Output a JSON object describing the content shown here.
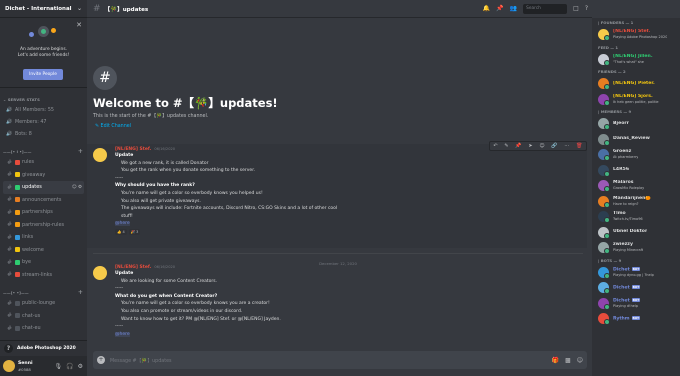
{
  "server": {
    "name": "Dichet - International"
  },
  "invite": {
    "line1": "An adventure begins.",
    "line2": "Let's add some friends!",
    "button": "Invite People"
  },
  "categories": {
    "stats": "SERVER STATS",
    "info": "——[• i •]——",
    "chat": "——[• •]——"
  },
  "stats": [
    {
      "label": "All Members: 55"
    },
    {
      "label": "Members: 47"
    },
    {
      "label": "Bots: 8"
    }
  ],
  "channels_info": [
    {
      "name": "rules",
      "emoji": "#e74c3c",
      "active": false
    },
    {
      "name": "giveaway",
      "emoji": "#f1c40f",
      "active": false
    },
    {
      "name": "updates",
      "emoji": "#2ecc71",
      "active": true
    },
    {
      "name": "announcements",
      "emoji": "#e67e22",
      "active": false
    },
    {
      "name": "partnerships",
      "emoji": "#f39c12",
      "active": false
    },
    {
      "name": "partnership-rules",
      "emoji": "#f39c12",
      "active": false
    },
    {
      "name": "links",
      "emoji": "#3498db",
      "active": false
    },
    {
      "name": "welcome",
      "emoji": "#f1c40f",
      "active": false
    },
    {
      "name": "bye",
      "emoji": "#2ecc71",
      "active": false
    },
    {
      "name": "stream-links",
      "emoji": "#e74c3c",
      "active": false
    }
  ],
  "channels_chat": [
    {
      "name": "public-lounge"
    },
    {
      "name": "chat-us"
    },
    {
      "name": "chat-eu"
    }
  ],
  "now_playing": "Adobe Photoshop 2020",
  "user": {
    "name": "Senni",
    "tag": "#0588"
  },
  "header": {
    "channel": "【🎋】updates",
    "search_placeholder": "Search"
  },
  "welcome": {
    "title": "Welcome to #【🎋】updates!",
    "subtitle": "This is the start of the #【🎋】updates channel.",
    "edit": "✎ Edit Channel"
  },
  "messages": [
    {
      "author": "[NL/ENG] Stef.",
      "time": "06/16/2020",
      "lines": [
        {
          "text": "Update",
          "style": "bold"
        },
        {
          "text": "We got a new rank, it is called Donator",
          "style": ""
        },
        {
          "text": "You get the rank when you donate something to the server.",
          "style": ""
        },
        {
          "text": "-----",
          "style": ""
        },
        {
          "text": "Why should you have the rank?",
          "style": "bold"
        },
        {
          "text": "You're name will get a color so everbody knows you helped us!",
          "style": ""
        },
        {
          "text": "You also will get private giveaways.",
          "style": ""
        },
        {
          "text": "The giveaways will include: Fortnite accounts, Discord Nitro, CS:GO Skins and a lot of other cool",
          "style": ""
        },
        {
          "text": "stuff!",
          "style": ""
        },
        {
          "text": "@here",
          "style": "mention"
        }
      ],
      "reactions": [
        "👍 4",
        "🎉 3"
      ]
    },
    {
      "author": "[NL/ENG] Stef.",
      "time": "06/16/2020",
      "lines": [
        {
          "text": "Update",
          "style": "bold"
        },
        {
          "text": "We are looking for some Content Creators.",
          "style": ""
        },
        {
          "text": "-----",
          "style": ""
        },
        {
          "text": "What do you get when Content Creator?",
          "style": "bold"
        },
        {
          "text": "You're name will get a color so everbody knows you are a creator!",
          "style": ""
        },
        {
          "text": "You also can promote or stream/videos in our discord.",
          "style": ""
        },
        {
          "text": "Want to know how to get it? PM @[NL/ENG] Stef. or @[NL/ENG] Jayden.",
          "style": ""
        },
        {
          "text": "-----",
          "style": ""
        },
        {
          "text": "@here",
          "style": "mention"
        }
      ],
      "reactions": []
    }
  ],
  "date_separator": "December 12, 2020",
  "composer": {
    "placeholder": "Message #【🎋】updates"
  },
  "member_groups": [
    {
      "title": "| FOUNDERS — 1",
      "members": [
        {
          "name": "[NL/ENG] Stef.",
          "status": "Playing Adobe Photoshop 2020",
          "color": "#e74c3c",
          "avatar": "#f6ca4a"
        }
      ]
    },
    {
      "title": "FEED — 1",
      "members": [
        {
          "name": "[NL/ENG] Jillen.",
          "status": "\"That's what\" she",
          "color": "#2ecc71",
          "avatar": "#c9cdd6"
        }
      ]
    },
    {
      "title": "FRIENDS — 2",
      "members": [
        {
          "name": "[NL/ENG] Pieter.",
          "status": "",
          "color": "#f1c40f",
          "avatar": "#e67e22"
        },
        {
          "name": "[NL/ENG] Sjors.",
          "status": "Ik heb geen politie, politie",
          "color": "#f1c40f",
          "avatar": "#8e44ad"
        }
      ]
    },
    {
      "title": "| MEMBERS — 9",
      "members": [
        {
          "name": "Bjeorr",
          "status": "",
          "color": "#dcddde",
          "avatar": "#95a5a6"
        },
        {
          "name": "Danas_Review",
          "status": "",
          "color": "#dcddde",
          "avatar": "#7f8c8d"
        },
        {
          "name": "Groenz",
          "status": "At pharmberry",
          "color": "#dcddde",
          "avatar": "#4a6fa5"
        },
        {
          "name": "L4R56",
          "status": "",
          "color": "#dcddde",
          "avatar": "#34495e"
        },
        {
          "name": "Malaros",
          "status": "GrowMix Roleplay",
          "color": "#dcddde",
          "avatar": "#9b59b6"
        },
        {
          "name": "Mandarijnen🍊",
          "status": "Have to reign?",
          "color": "#dcddde",
          "avatar": "#e67e22"
        },
        {
          "name": "Tlmo",
          "status": "Twitch.tv/Timo96",
          "color": "#dcddde",
          "avatar": "#2c3e50"
        },
        {
          "name": "Ubnel Doktor",
          "status": "",
          "color": "#dcddde",
          "avatar": "#bdc3c7"
        },
        {
          "name": "zwiezzy",
          "status": "Playing Minecraft",
          "color": "#dcddde",
          "avatar": "#95a5a6"
        }
      ]
    },
    {
      "title": "| BOTS — 9",
      "members": [
        {
          "name": "Dichet",
          "status": "Playing dyno.gg | ?help",
          "color": "#7289da",
          "avatar": "#3498db",
          "bot": "BOT"
        },
        {
          "name": "Dichet",
          "status": "",
          "color": "#7289da",
          "avatar": "#5dade2",
          "bot": "BOT"
        },
        {
          "name": "Dichet",
          "status": "Playing d!help",
          "color": "#7289da",
          "avatar": "#8e44ad",
          "bot": "BOT"
        },
        {
          "name": "Rythm",
          "status": "",
          "color": "#7289da",
          "avatar": "#e74c3c",
          "bot": "BOT"
        }
      ]
    }
  ]
}
